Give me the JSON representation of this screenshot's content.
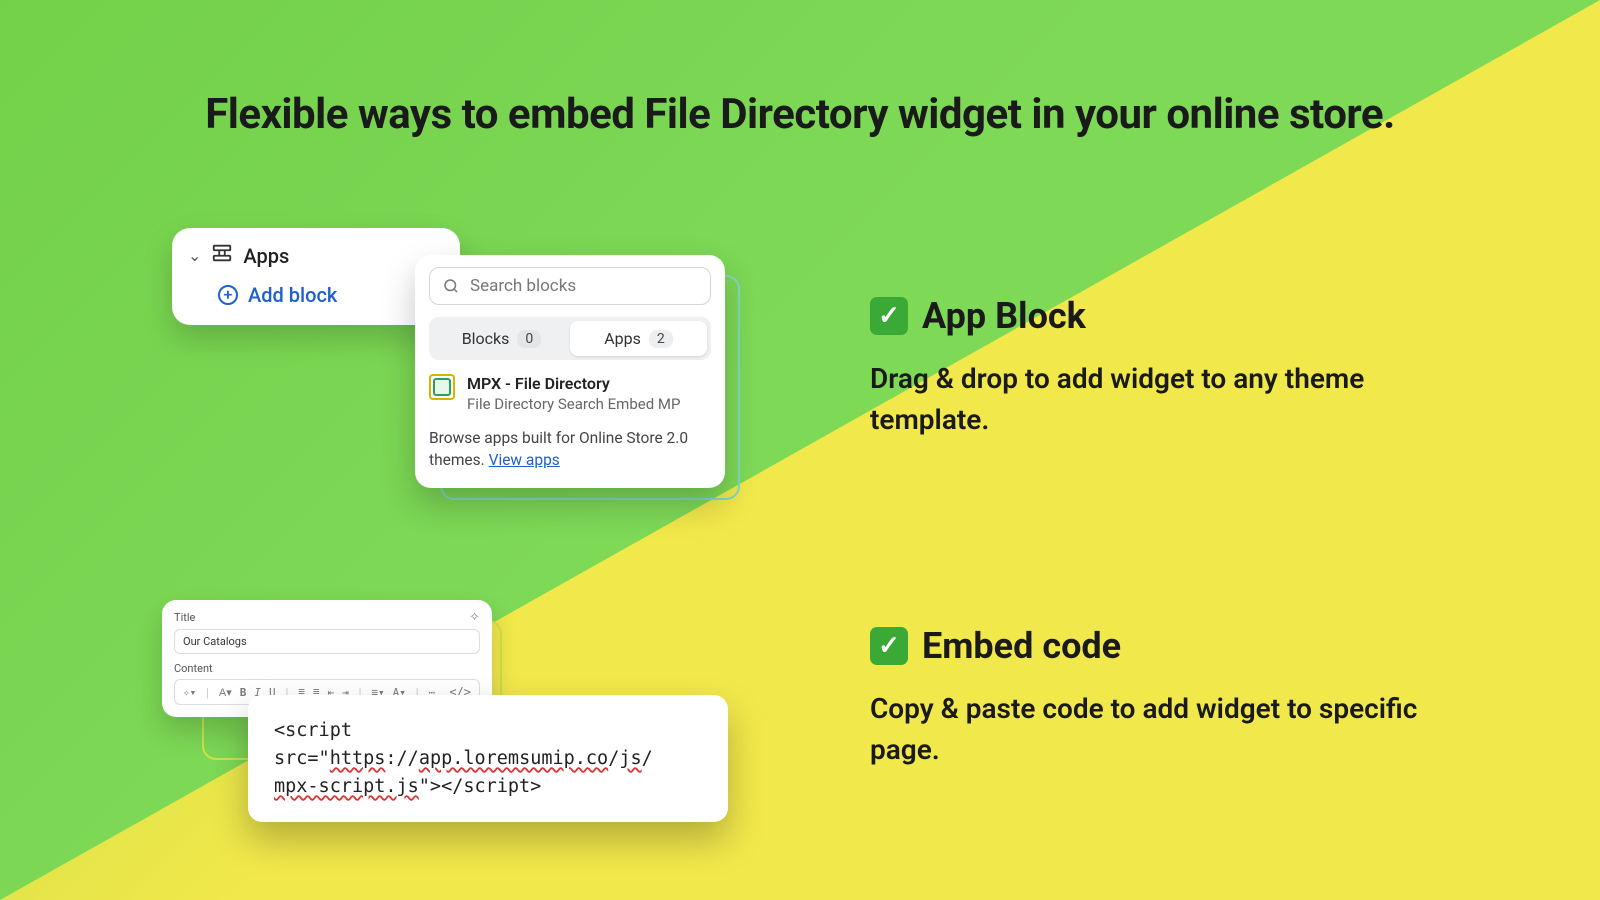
{
  "headline": "Flexible ways to embed File Directory widget in your online store.",
  "appsCard": {
    "title": "Apps",
    "addLabel": "Add block"
  },
  "popover": {
    "searchPlaceholder": "Search blocks",
    "tabBlocksLabel": "Blocks",
    "tabBlocksCount": "0",
    "tabAppsLabel": "Apps",
    "tabAppsCount": "2",
    "appTitle": "MPX - File Directory",
    "appSubtitle": "File Directory Search Embed MP",
    "footPrefix": "Browse apps built for Online Store 2.0 themes. ",
    "footLink": "View apps"
  },
  "editor": {
    "titleLabel": "Title",
    "titleValue": "Our Catalogs",
    "contentLabel": "Content"
  },
  "snippet": {
    "p1a": "<script src=\"",
    "p1b": "https",
    "p1c": "://",
    "p1d": "app.loremsumip.co",
    "p1e": "/",
    "p1f": "js",
    "p1g": "/",
    "p2a": "mpx-script.js",
    "p2b": "\"></scr",
    "p2c": "ipt>"
  },
  "features": {
    "block": {
      "title": "App Block",
      "desc": "Drag & drop to add widget to any theme template."
    },
    "code": {
      "title": "Embed code",
      "desc": "Copy & paste code to add widget to specific page."
    }
  }
}
